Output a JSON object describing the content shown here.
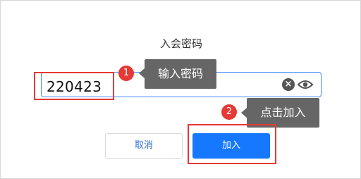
{
  "dialog": {
    "title": "入会密码",
    "password_value": "220423",
    "clear_icon": "clear-icon",
    "eye_icon": "eye-icon",
    "cancel_label": "取消",
    "join_label": "加入"
  },
  "annotations": {
    "step1_number": "1",
    "step1_text": "输入密码",
    "step2_number": "2",
    "step2_text": "点击加入",
    "highlight_color": "#e53935",
    "tooltip_color": "#666666"
  },
  "colors": {
    "primary": "#1677ff",
    "input_border": "#3e86f5"
  }
}
